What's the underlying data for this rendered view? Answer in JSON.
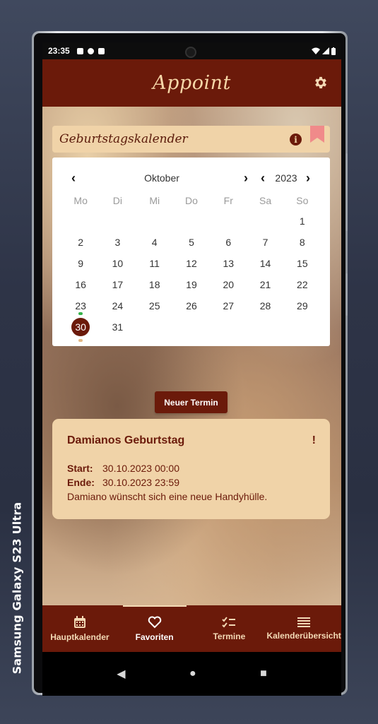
{
  "device": {
    "label": "Samsung Galaxy  S23 Ultra"
  },
  "statusbar": {
    "time": "23:35"
  },
  "appbar": {
    "title": "Appoint",
    "settings_icon": "gear-icon"
  },
  "calendar_header": {
    "title": "Geburtstagskalender",
    "info_icon": "info-icon",
    "bookmark_icon": "bookmark-icon",
    "accent": "#f08a8a"
  },
  "calendar": {
    "month": "Oktober",
    "year": "2023",
    "weekdays": [
      "Mo",
      "Di",
      "Mi",
      "Do",
      "Fr",
      "Sa",
      "So"
    ],
    "weeks": [
      [
        "",
        "",
        "",
        "",
        "",
        "",
        "1"
      ],
      [
        "2",
        "3",
        "4",
        "5",
        "6",
        "7",
        "8"
      ],
      [
        "9",
        "10",
        "11",
        "12",
        "13",
        "14",
        "15"
      ],
      [
        "16",
        "17",
        "18",
        "19",
        "20",
        "21",
        "22"
      ],
      [
        "23",
        "24",
        "25",
        "26",
        "27",
        "28",
        "29"
      ],
      [
        "30",
        "31",
        "",
        "",
        "",
        "",
        ""
      ]
    ],
    "selected_day": "30",
    "marked_days": {
      "23": "#36b24a",
      "30": "#e3b884"
    }
  },
  "new_button": {
    "label": "Neuer Termin"
  },
  "event": {
    "title": "Damianos Geburtstag",
    "priority": "!",
    "start_label": "Start:",
    "start_value": "30.10.2023 00:00",
    "end_label": "Ende:",
    "end_value": "30.10.2023 23:59",
    "description": "Damiano wünscht sich eine neue Handyhülle."
  },
  "bottom_nav": {
    "items": [
      {
        "label": "Hauptkalender",
        "icon": "calendar-icon"
      },
      {
        "label": "Favoriten",
        "icon": "heart-icon"
      },
      {
        "label": "Termine",
        "icon": "checklist-icon"
      },
      {
        "label": "Kalenderübersicht",
        "icon": "list-icon"
      }
    ],
    "active_index": 1
  },
  "system_nav": {
    "back": "◀",
    "home": "●",
    "recents": "■"
  },
  "colors": {
    "primary": "#6b1a0a",
    "surface": "#f0d3a8",
    "text_on_primary": "#f3d9b5"
  }
}
